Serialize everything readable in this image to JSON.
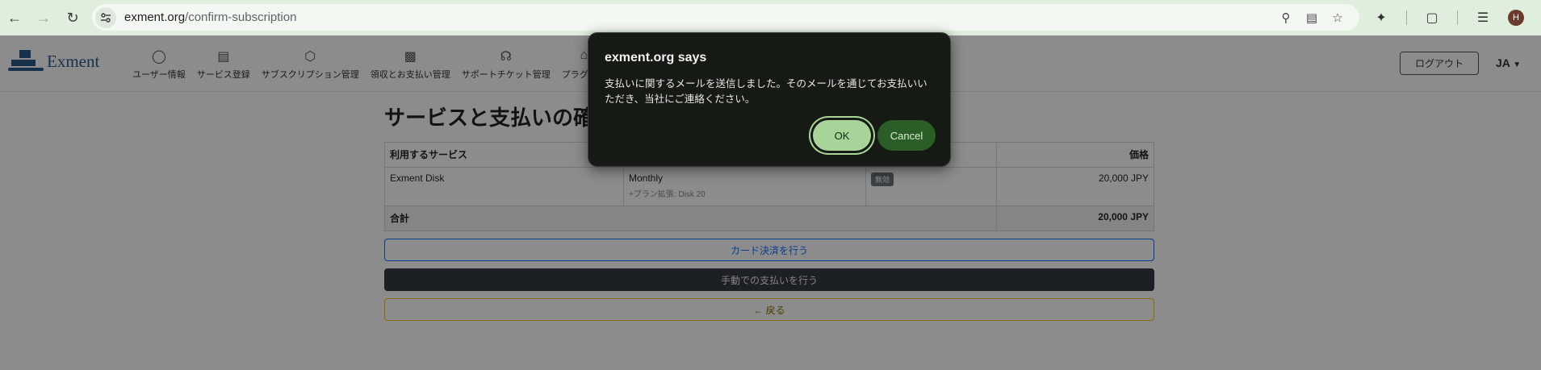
{
  "browser": {
    "url_host": "exment.org",
    "url_path": "/confirm-subscription",
    "avatar_letter": "H"
  },
  "header": {
    "logo_text": "Exment",
    "menu": [
      {
        "label": "ユーザー情報",
        "icon": "user-icon"
      },
      {
        "label": "サービス登録",
        "icon": "server-icon"
      },
      {
        "label": "サブスクリプション管理",
        "icon": "box-icon"
      },
      {
        "label": "領収とお支払い管理",
        "icon": "wallet-icon"
      },
      {
        "label": "サポートチケット管理",
        "icon": "headset-icon"
      },
      {
        "label": "プラグイン",
        "icon": "plugin-icon"
      }
    ],
    "logout_label": "ログアウト",
    "lang_label": "JA"
  },
  "main": {
    "title": "サービスと支払いの確認",
    "table": {
      "headers": [
        "利用するサービス",
        "",
        "",
        "価格"
      ],
      "row": {
        "service": "Exment Disk",
        "plan": "Monthly",
        "plan_detail": "+プラン拡張: Disk 20",
        "status_badge": "無効",
        "price": "20,000 JPY"
      },
      "total_label": "合計",
      "total_value": "20,000 JPY"
    },
    "card_button": "カード決済を行う",
    "manual_button": "手動での支払いを行う",
    "back_button": "← 戻る"
  },
  "dialog": {
    "title": "exment.org says",
    "message": "支払いに関するメールを送信しました。そのメールを通じてお支払いいただき、当社にご連絡ください。",
    "ok_label": "OK",
    "cancel_label": "Cancel"
  }
}
